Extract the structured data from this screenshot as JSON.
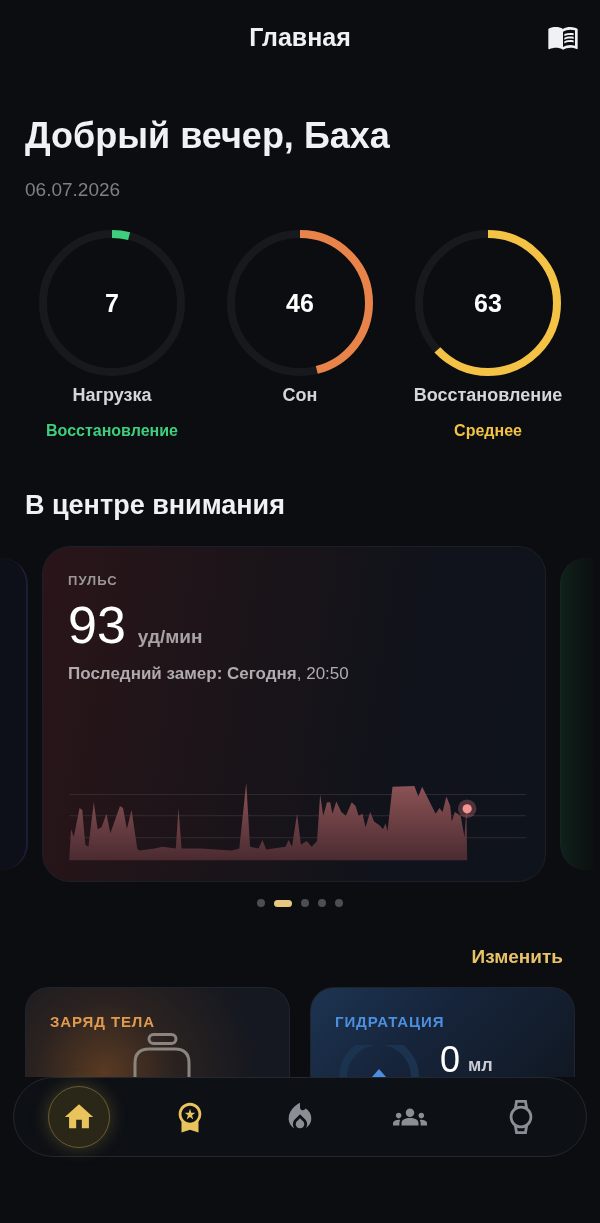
{
  "header": {
    "title": "Главная"
  },
  "greeting": {
    "title": "Добрый вечер, Баха",
    "date": "06.07.2026"
  },
  "metrics": [
    {
      "label": "Нагрузка",
      "value": "7",
      "level": 0.04,
      "color": "#3ecf7e",
      "status": "Восстановление"
    },
    {
      "label": "Сон",
      "value": "46",
      "level": 0.46,
      "color": "#e8834a"
    },
    {
      "label": "Восстановление",
      "value": "63",
      "level": 0.63,
      "color": "#f4c244",
      "status": "Среднее"
    }
  ],
  "spotlight": {
    "title": "В центре внимания",
    "card": {
      "label": "ПУЛЬС",
      "value": "93",
      "unit": "уд/мин",
      "last_measured": "**Последний замер: Сегодня**, 20:50"
    },
    "pages": [
      {
        "selected": false
      },
      {
        "selected": true
      },
      {
        "selected": false
      },
      {
        "selected": false
      },
      {
        "selected": false
      }
    ]
  },
  "widgets": {
    "edit_label": "Изменить",
    "cards": [
      {
        "kind": "battery",
        "title": "ЗАРЯД ТЕЛА",
        "color": "#e09a4e"
      },
      {
        "kind": "hydration",
        "title": "ГИДРАТАЦИЯ",
        "color": "#4d8fdf",
        "value": "0",
        "unit": "мл"
      }
    ]
  },
  "nav": {
    "items": [
      {
        "selected": true
      },
      {
        "selected": false
      },
      {
        "selected": false
      },
      {
        "selected": false
      },
      {
        "selected": false
      }
    ]
  }
}
